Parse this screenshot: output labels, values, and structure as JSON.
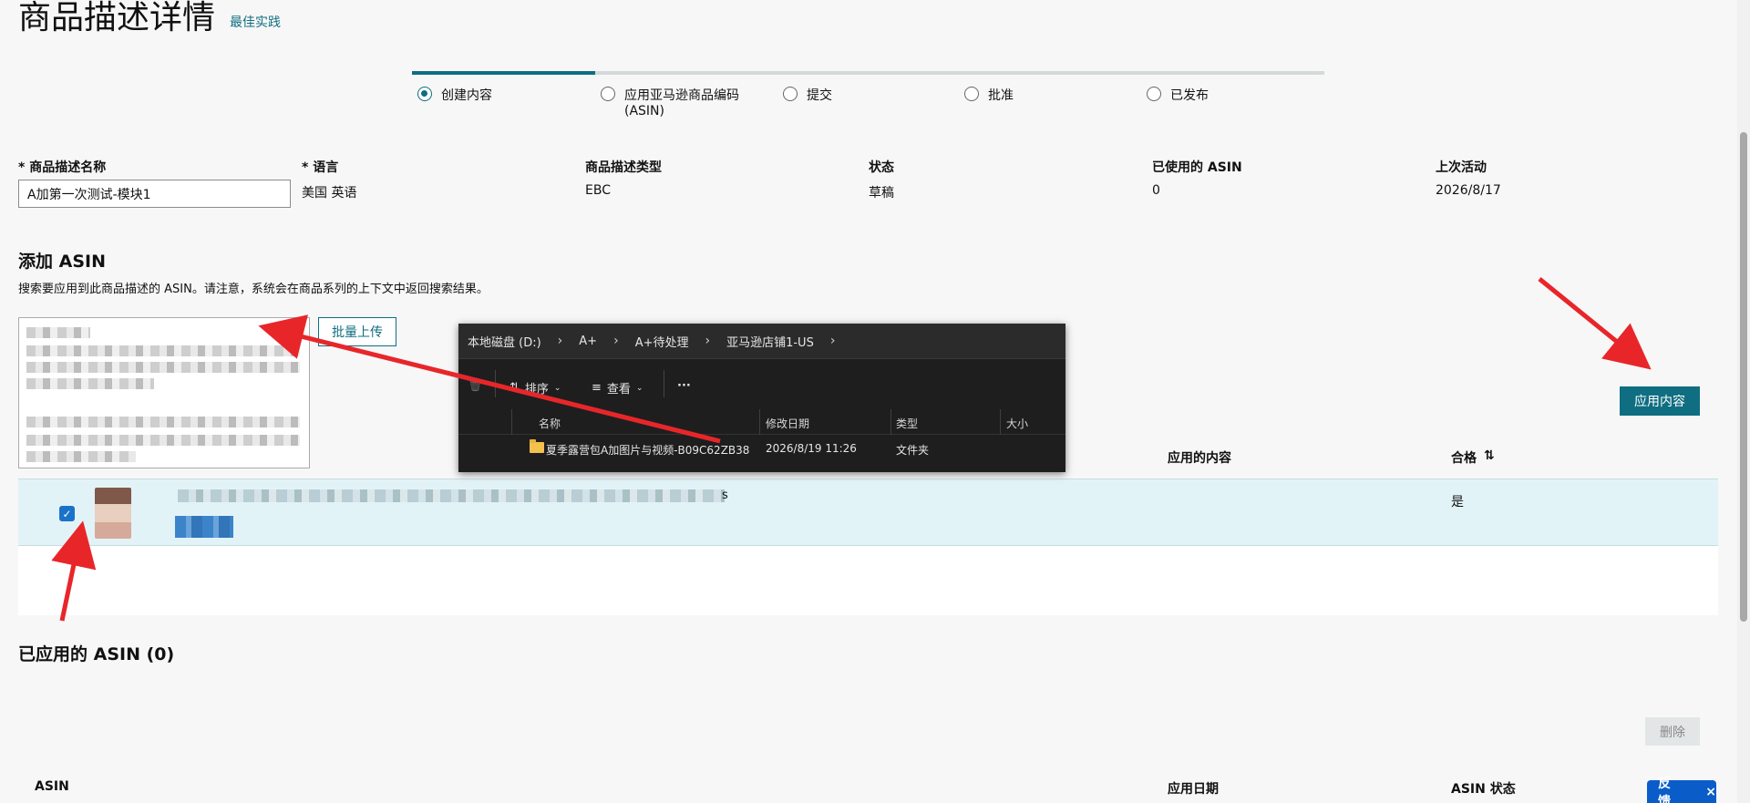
{
  "page": {
    "title": "商品描述详情",
    "best_practice_link": "最佳实践"
  },
  "steps": [
    {
      "label": "创建内容",
      "checked": true
    },
    {
      "label": "应用亚马逊商品编码",
      "label2": "(ASIN)",
      "checked": false
    },
    {
      "label": "提交",
      "checked": false
    },
    {
      "label": "批准",
      "checked": false
    },
    {
      "label": "已发布",
      "checked": false
    }
  ],
  "info": {
    "name_label": "* 商品描述名称",
    "name_value": "A加第一次测试-模块1",
    "language_label": "* 语言",
    "language_value": "美国 英语",
    "type_label": "商品描述类型",
    "type_value": "EBC",
    "status_label": "状态",
    "status_value": "草稿",
    "used_asin_label": "已使用的 ASIN",
    "used_asin_value": "0",
    "last_activity_label": "上次活动",
    "last_activity_value": "2026/8/17"
  },
  "add_asin": {
    "heading": "添加 ASIN",
    "description": "搜索要应用到此商品描述的 ASIN。请注意，系统会在商品系列的上下文中返回搜索结果。",
    "bulk_upload": "批量上传",
    "apply_button": "应用内容",
    "columns": {
      "applied_content": "应用的内容",
      "eligible": "合格",
      "sort_icon": "sort-icon"
    },
    "result": {
      "title_suffix": "s",
      "eligible_value": "是",
      "selected": true
    }
  },
  "applied": {
    "heading": "已应用的 ASIN (0)",
    "delete_button": "删除",
    "columns": {
      "asin": "ASIN",
      "apply_date": "应用日期",
      "asin_status": "ASIN 状态"
    }
  },
  "feedback": {
    "label": "反馈",
    "close": "×"
  },
  "explorer": {
    "breadcrumb": [
      "本地磁盘 (D:)",
      "A+",
      "A+待处理",
      "亚马逊店铺1-US"
    ],
    "sort": "排序",
    "view": "查看",
    "more": "···",
    "columns": {
      "name": "名称",
      "modified": "修改日期",
      "type": "类型",
      "size": "大小"
    },
    "row": {
      "name": "夏季露营包A加图片与视频-B09C62ZB38",
      "modified": "2026/8/19 11:26",
      "type": "文件夹"
    }
  },
  "colors": {
    "accent": "#0f6e81",
    "arrow": "#e8262a",
    "row_selected": "#e2f3f7",
    "feedback": "#0a5cc9"
  }
}
